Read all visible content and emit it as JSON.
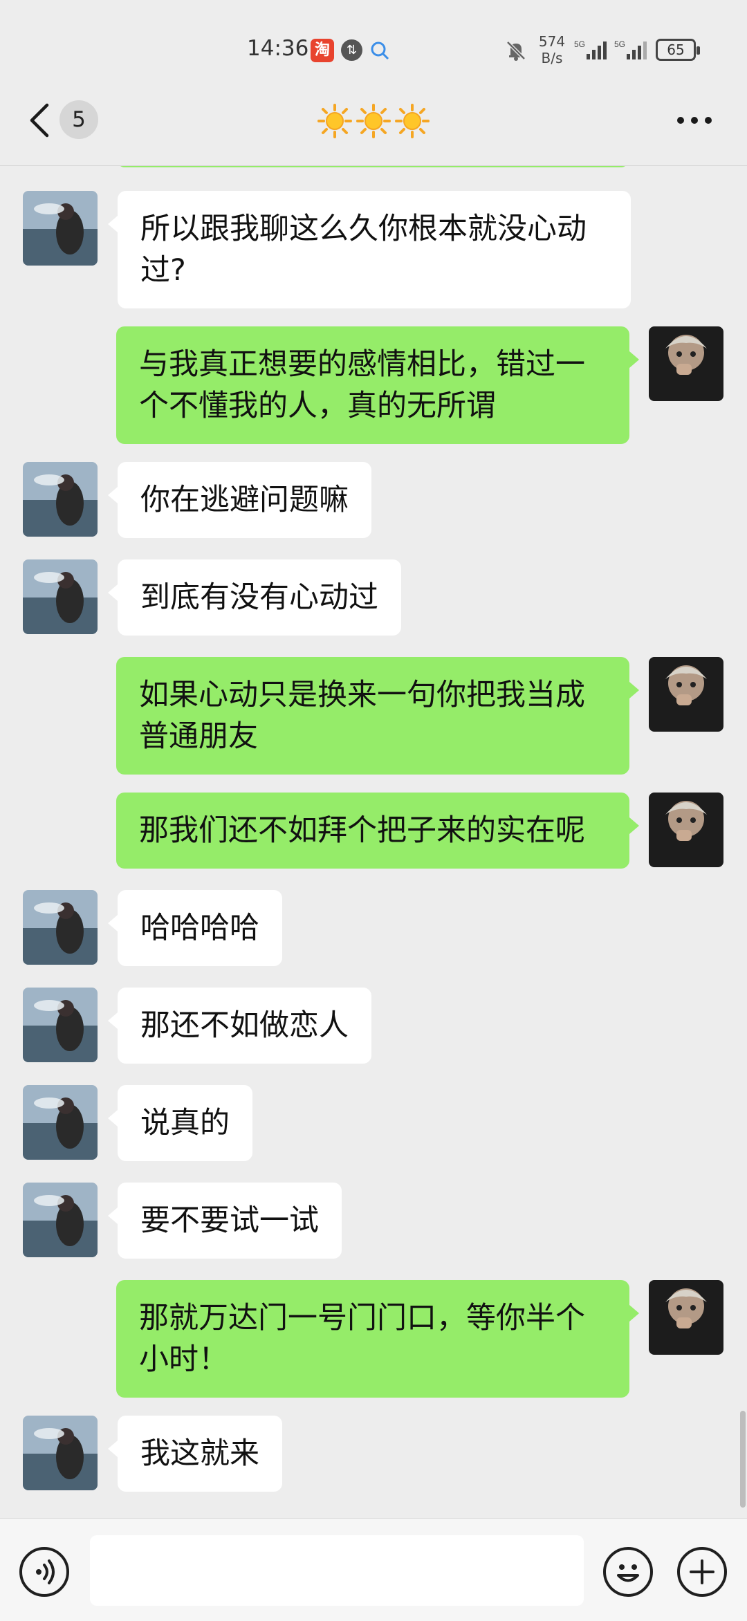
{
  "status_bar": {
    "time": "14:36",
    "taobao_icon": "淘",
    "network_speed_value": "574",
    "network_speed_unit": "B/s",
    "signal_1": "5G",
    "signal_2": "5G",
    "battery": "65"
  },
  "nav": {
    "back_icon": "chevron-left-icon",
    "unread_count": "5",
    "title_icons": [
      "sun-icon",
      "sun-icon",
      "sun-icon"
    ],
    "more_icon": "more-horizontal-icon"
  },
  "messages": [
    {
      "side": "left",
      "text": "所以跟我聊这么久你根本就没心动过?"
    },
    {
      "side": "right",
      "text": "与我真正想要的感情相比，错过一个不懂我的人，真的无所谓"
    },
    {
      "side": "left",
      "text": "你在逃避问题嘛"
    },
    {
      "side": "left",
      "text": "到底有没有心动过"
    },
    {
      "side": "right",
      "text": "如果心动只是换来一句你把我当成普通朋友"
    },
    {
      "side": "right",
      "text": "那我们还不如拜个把子来的实在呢"
    },
    {
      "side": "left",
      "text": "哈哈哈哈"
    },
    {
      "side": "left",
      "text": "那还不如做恋人"
    },
    {
      "side": "left",
      "text": "说真的"
    },
    {
      "side": "left",
      "text": "要不要试一试"
    },
    {
      "side": "right",
      "text": "那就万达门一号门门口，等你半个小时！"
    },
    {
      "side": "left",
      "text": "我这就来"
    }
  ],
  "input_bar": {
    "voice_icon": "voice-icon",
    "input_value": "",
    "emoji_icon": "emoji-icon",
    "plus_icon": "plus-icon"
  },
  "colors": {
    "background": "#ededed",
    "bubble_sent": "#95ec69",
    "bubble_received": "#ffffff"
  }
}
